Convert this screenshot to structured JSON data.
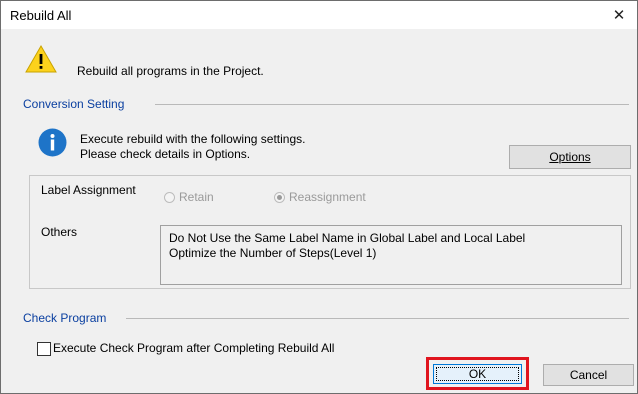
{
  "window": {
    "title": "Rebuild All",
    "close_glyph": "✕"
  },
  "warning": {
    "icon": "warning-icon",
    "text": "Rebuild all programs in the Project."
  },
  "conversion": {
    "group_title": "Conversion Setting",
    "info_icon": "info-icon",
    "info_line1": "Execute rebuild with the following settings.",
    "info_line2": "Please check details in Options.",
    "options_button": "Options",
    "label_assignment": {
      "label": "Label Assignment",
      "options": [
        "Retain",
        "Reassignment"
      ],
      "selected": "Reassignment",
      "enabled": false
    },
    "others": {
      "label": "Others",
      "lines": [
        "Do Not Use the Same Label Name in Global Label and Local Label",
        "Optimize the Number of Steps(Level 1)"
      ]
    }
  },
  "check_program": {
    "group_title": "Check Program",
    "checkbox_label": "Execute Check Program after Completing Rebuild All",
    "checked": false
  },
  "buttons": {
    "ok": "OK",
    "cancel": "Cancel"
  },
  "colors": {
    "group_title": "#0a3fa0",
    "highlight": "#e0141e",
    "dialog_bg": "#f0f0f0"
  }
}
